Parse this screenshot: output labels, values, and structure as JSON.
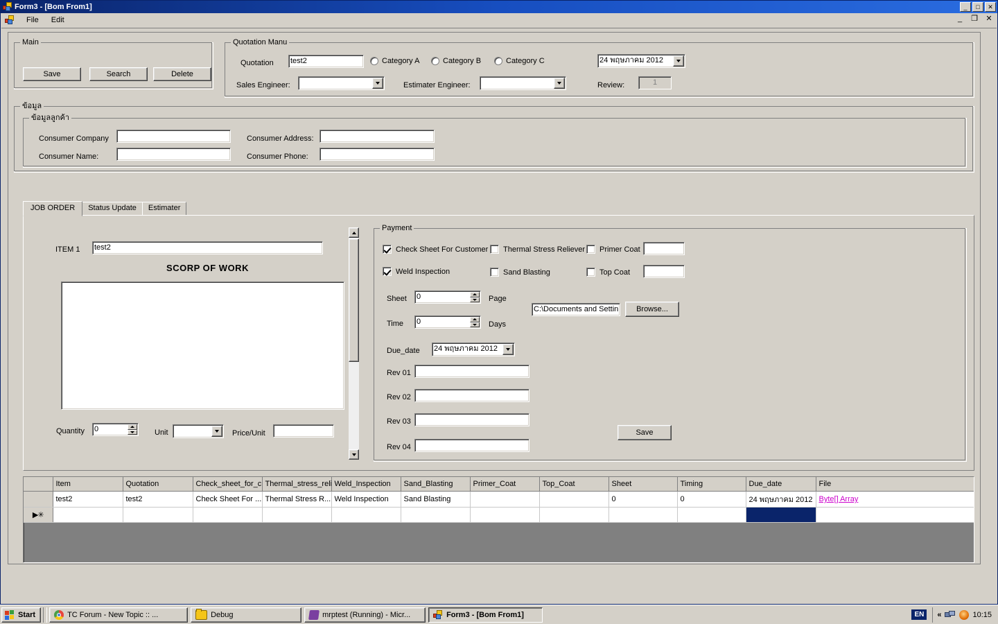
{
  "window": {
    "title": "Form3 - [Bom From1]",
    "app_icon": "vb-app-icon",
    "minimize": "_",
    "maximize": "□",
    "close": "✕"
  },
  "menubar": {
    "mdi_icon": "vb-child-icon",
    "items": [
      {
        "label": "File"
      },
      {
        "label": "Edit"
      }
    ],
    "mdi_minimize": "_",
    "mdi_restore": "❐",
    "mdi_close": "✕"
  },
  "main_group": {
    "legend": "Main",
    "buttons": [
      {
        "label": "Save"
      },
      {
        "label": "Search"
      },
      {
        "label": "Delete"
      }
    ]
  },
  "quotation_group": {
    "legend": "Quotation Manu",
    "quotation_label": "Quotation",
    "quotation_value": "test2",
    "categories": [
      {
        "label": "Category A",
        "checked": false
      },
      {
        "label": "Category B",
        "checked": false
      },
      {
        "label": "Category C",
        "checked": false
      }
    ],
    "date_value": "24 พฤษภาคม  2012",
    "sales_engineer_label": "Sales Engineer:",
    "sales_engineer_value": "",
    "estimater_engineer_label": "Estimater Engineer:",
    "estimater_engineer_value": "",
    "review_label": "Review:",
    "review_value": "1"
  },
  "data_group": {
    "legend": "ข้อมูล",
    "customer_legend": "ข้อมูลลูกค้า",
    "fields": [
      {
        "label": "Consumer Company",
        "value": ""
      },
      {
        "label": "Consumer Address:",
        "value": ""
      },
      {
        "label": "Consumer Name:",
        "value": ""
      },
      {
        "label": "Consumer Phone:",
        "value": ""
      }
    ]
  },
  "tabs": [
    {
      "label": "JOB ORDER",
      "active": true
    },
    {
      "label": "Status Update",
      "active": false
    },
    {
      "label": "Estimater",
      "active": false
    }
  ],
  "job_order": {
    "item_label": "ITEM 1",
    "item_value": "test2",
    "scope_title": "SCORP OF WORK",
    "scope_value": "",
    "quantity_label": "Quantity",
    "quantity_value": "0",
    "unit_label": "Unit",
    "unit_value": "",
    "price_label": "Price/Unit",
    "price_value": ""
  },
  "payment": {
    "legend": "Payment",
    "checkboxes": [
      {
        "label": "Check Sheet For Customer",
        "checked": true
      },
      {
        "label": "Thermal Stress Reliever",
        "checked": false
      },
      {
        "label": "Primer Coat",
        "checked": false
      },
      {
        "label": "Weld Inspection",
        "checked": true
      },
      {
        "label": "Sand Blasting",
        "checked": false
      },
      {
        "label": "Top Coat",
        "checked": false
      }
    ],
    "primer_coat_value": "",
    "top_coat_value": "",
    "sheet_label": "Sheet",
    "sheet_value": "0",
    "page_label": "Page",
    "time_label": "Time",
    "time_value": "0",
    "days_label": "Days",
    "file_path_value": "C:\\Documents and Settin",
    "browse_label": "Browse...",
    "due_date_label": "Due_date",
    "due_date_value": "24 พฤษภาคม  2012",
    "revisions": [
      {
        "label": "Rev 01",
        "value": ""
      },
      {
        "label": "Rev 02",
        "value": ""
      },
      {
        "label": "Rev 03",
        "value": ""
      },
      {
        "label": "Rev 04",
        "value": ""
      }
    ],
    "save_label": "Save"
  },
  "grid": {
    "columns": [
      "Item",
      "Quotation",
      "Check_sheet_for_c",
      "Thermal_stress_reli",
      "Weld_Inspection",
      "Sand_Blasting",
      "Primer_Coat",
      "Top_Coat",
      "Sheet",
      "Timing",
      "Due_date",
      "File"
    ],
    "rows": [
      {
        "marker": "",
        "cells": [
          "test2",
          "test2",
          "Check Sheet For ...",
          "Thermal Stress R...",
          "Weld Inspection",
          "Sand Blasting",
          "",
          "",
          "0",
          "0",
          "24 พฤษภาคม 2012",
          "Byte[] Array"
        ]
      },
      {
        "marker": "▶✳",
        "cells": [
          "",
          "",
          "",
          "",
          "",
          "",
          "",
          "",
          "",
          "",
          "",
          ""
        ]
      }
    ],
    "selected_cell": {
      "row": 1,
      "col": 10
    },
    "file_link_color": "#cc00cc"
  },
  "taskbar": {
    "start_label": "Start",
    "tasks": [
      {
        "label": "TC Forum - New Topic :: ...",
        "icon": "chrome-icon",
        "active": false
      },
      {
        "label": "Debug",
        "icon": "folder-icon",
        "active": false
      },
      {
        "label": "mrptest (Running) - Micr...",
        "icon": "visual-studio-icon",
        "active": false
      },
      {
        "label": "Form3 - [Bom From1]",
        "icon": "vb-app-icon",
        "active": true
      }
    ],
    "language": "EN",
    "tray_chevron": "«",
    "tray_icons": [
      "network-icon",
      "update-icon"
    ],
    "clock": "10:15"
  }
}
